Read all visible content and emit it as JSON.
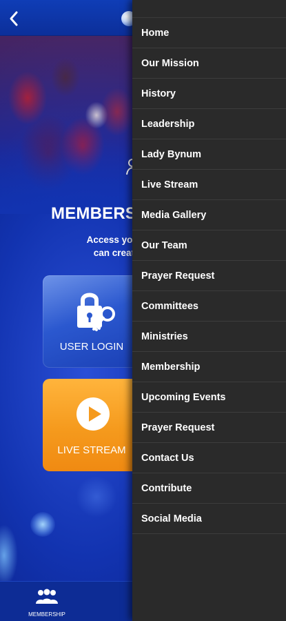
{
  "header": {
    "back_icon": "chevron-left-icon",
    "logo_icon": "globe-icon"
  },
  "membership": {
    "title": "MEMBERSHI",
    "description_line1": "Access your HTCOG",
    "description_line2": "can create an acc"
  },
  "tiles": [
    {
      "label": "USER LOGIN",
      "icon": "lock-key-icon",
      "color": "#2b58cf"
    },
    {
      "label": "LIVE STREAM",
      "icon": "play-icon",
      "color": "#f59a1d"
    }
  ],
  "tab_bar": {
    "membership_label": "MEMBERSHIP",
    "membership_icon": "group-icon"
  },
  "menu": {
    "items": [
      "Home",
      "Our Mission",
      "History",
      "Leadership",
      "Lady Bynum",
      "Live Stream",
      "Media Gallery",
      "Our Team",
      "Prayer Request",
      "Committees",
      "Ministries",
      "Membership",
      "Upcoming Events",
      "Prayer Request",
      "Contact Us",
      "Contribute",
      "Social Media"
    ]
  },
  "colors": {
    "background_blue": "#1233b0",
    "drawer_bg": "#2a2a2a",
    "login_tile": "#2b58cf",
    "live_tile": "#f59a1d"
  }
}
